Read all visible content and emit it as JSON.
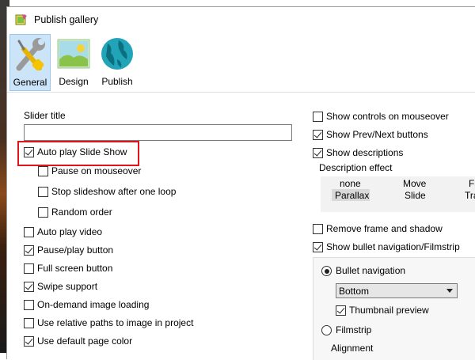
{
  "window": {
    "title": "Publish gallery"
  },
  "ribbon": {
    "buttons": [
      {
        "label": "General",
        "icon": "wrench-screwdriver-icon",
        "active": true
      },
      {
        "label": "Design",
        "icon": "landscape-picture-icon",
        "active": false
      },
      {
        "label": "Publish",
        "icon": "globe-icon",
        "active": false
      }
    ]
  },
  "left": {
    "slider_title_label": "Slider title",
    "slider_title_value": "",
    "options": [
      {
        "label": "Auto play Slide Show",
        "checked": true
      },
      {
        "label": "Pause on mouseover",
        "checked": false
      },
      {
        "label": "Stop slideshow after one loop",
        "checked": false
      },
      {
        "label": "Random order",
        "checked": false
      },
      {
        "label": "Auto play video",
        "checked": false
      },
      {
        "label": "Pause/play button",
        "checked": true
      },
      {
        "label": "Full screen button",
        "checked": false
      },
      {
        "label": "Swipe support",
        "checked": true
      },
      {
        "label": "On-demand image loading",
        "checked": false
      },
      {
        "label": "Use relative paths to image in project",
        "checked": false
      },
      {
        "label": "Use default page color",
        "checked": true
      }
    ]
  },
  "right": {
    "options_top": [
      {
        "label": "Show controls on mouseover",
        "checked": false
      },
      {
        "label": "Show Prev/Next buttons",
        "checked": true
      },
      {
        "label": "Show descriptions",
        "checked": true
      }
    ],
    "description_effect_label": "Description effect",
    "effects": {
      "row1": [
        "none",
        "Move",
        "Fa"
      ],
      "row2": [
        "Parallax",
        "Slide",
        "Tra"
      ],
      "selected": "Parallax"
    },
    "options_mid": [
      {
        "label": "Remove frame and shadow",
        "checked": false
      },
      {
        "label": "Show bullet navigation/Filmstrip",
        "checked": true
      }
    ],
    "nav": {
      "bullet_label": "Bullet navigation",
      "bullet_selected": true,
      "position_value": "Bottom",
      "thumbnail_label": "Thumbnail preview",
      "thumbnail_checked": true,
      "filmstrip_label": "Filmstrip",
      "filmstrip_selected": false,
      "alignment_label": "Alignment"
    }
  },
  "colors": {
    "highlight": "#e0141b",
    "ribbon_active": "#cce4f7"
  }
}
